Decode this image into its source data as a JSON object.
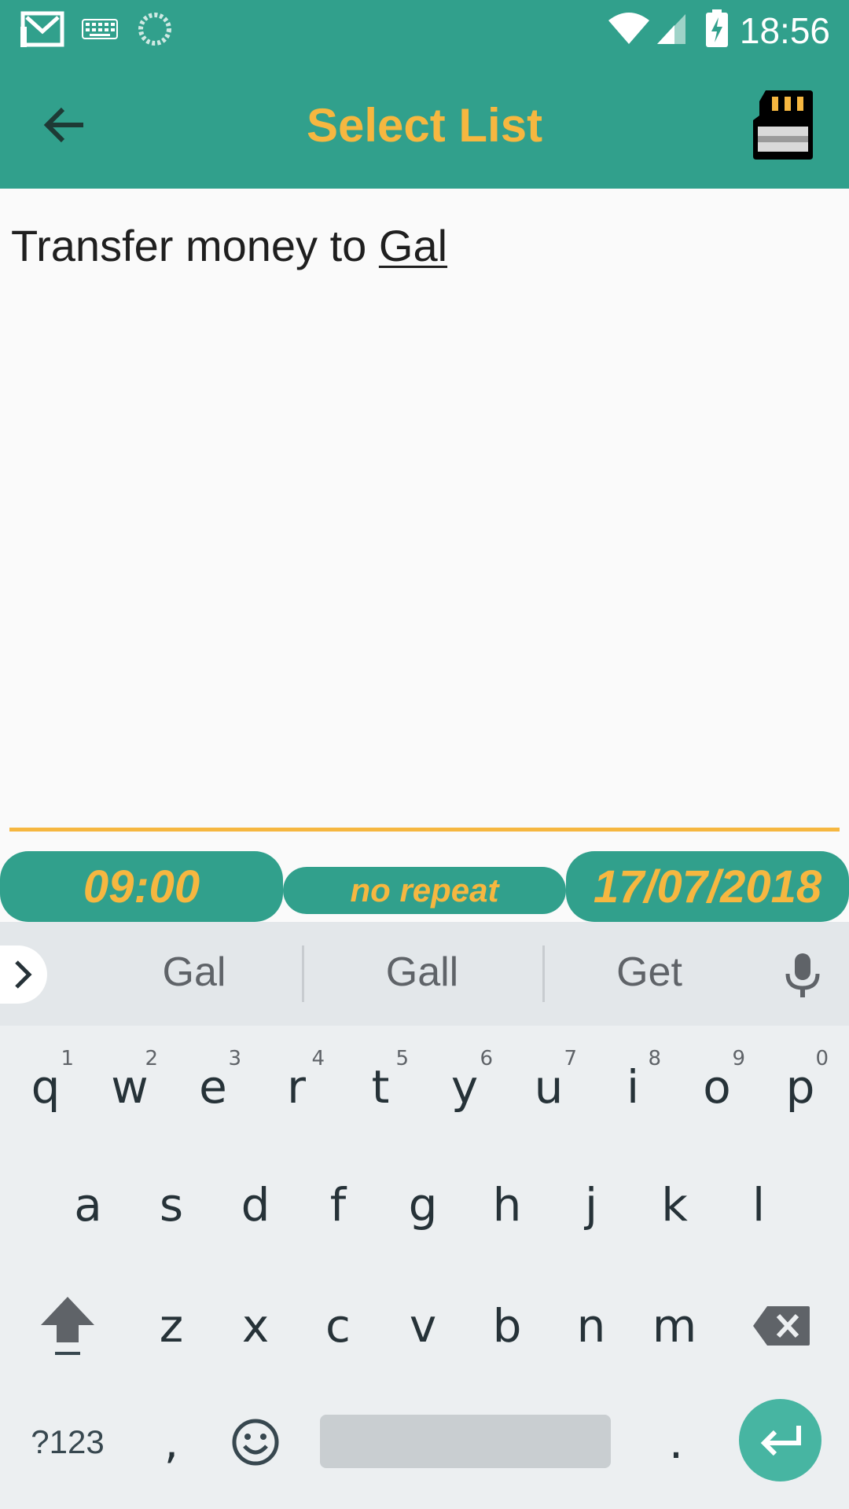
{
  "status_bar": {
    "time": "18:56",
    "icons": [
      "gmail-icon",
      "keyboard-icon",
      "sync-icon",
      "wifi-icon",
      "signal-icon",
      "battery-charging-icon"
    ]
  },
  "app_bar": {
    "title": "Select List",
    "back_icon": "back-arrow-icon",
    "action_icon": "sd-card-icon"
  },
  "editor": {
    "text_prefix": "Transfer money to ",
    "text_underlined": "Gal"
  },
  "buttons": {
    "time": "09:00",
    "repeat": "no repeat",
    "date": "17/07/2018"
  },
  "keyboard": {
    "suggestions": [
      "Gal",
      "Gall",
      "Get"
    ],
    "row1": [
      {
        "key": "q",
        "num": "1"
      },
      {
        "key": "w",
        "num": "2"
      },
      {
        "key": "e",
        "num": "3"
      },
      {
        "key": "r",
        "num": "4"
      },
      {
        "key": "t",
        "num": "5"
      },
      {
        "key": "y",
        "num": "6"
      },
      {
        "key": "u",
        "num": "7"
      },
      {
        "key": "i",
        "num": "8"
      },
      {
        "key": "o",
        "num": "9"
      },
      {
        "key": "p",
        "num": "0"
      }
    ],
    "row2": [
      "a",
      "s",
      "d",
      "f",
      "g",
      "h",
      "j",
      "k",
      "l"
    ],
    "row3": [
      "z",
      "x",
      "c",
      "v",
      "b",
      "n",
      "m"
    ],
    "symbols_label": "?123",
    "comma": ",",
    "period": "."
  },
  "colors": {
    "primary": "#31a08c",
    "accent": "#f6b740",
    "enter": "#47b5a2"
  }
}
